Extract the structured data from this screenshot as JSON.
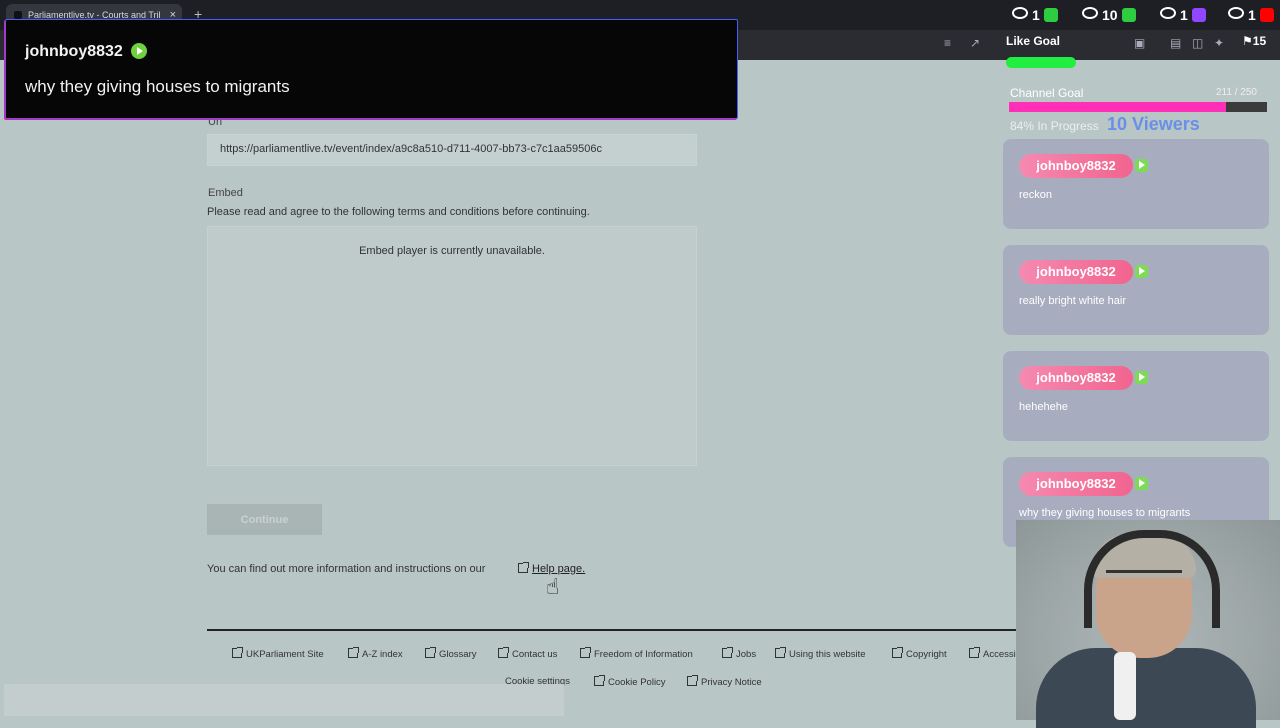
{
  "browser": {
    "tab_title": "Parliamentlive.tv - Courts and Tribu",
    "tab_close": "×",
    "new_tab": "+"
  },
  "stream_stats": [
    {
      "count": "1",
      "badge_color": "#2ecc40",
      "icon": "youtube-eye-icon"
    },
    {
      "count": "10",
      "badge_color": "#2ecc40",
      "icon": "kick-icon"
    },
    {
      "count": "1",
      "badge_color": "#9146ff",
      "icon": "twitch-icon"
    },
    {
      "count": "1",
      "badge_color": "#ff0000",
      "icon": "youtube-icon"
    }
  ],
  "chat_alert": {
    "username": "johnboy8832",
    "message": "why they giving houses to migrants"
  },
  "page": {
    "url_label": "Url",
    "url_value": "https://parliamentlive.tv/event/index/a9c8a510-d711-4007-bb73-c7c1aa59506c",
    "embed_label": "Embed",
    "terms_text": "Please read and agree to the following terms and conditions before continuing.",
    "embed_unavailable": "Embed player is currently unavailable.",
    "continue_label": "Continue",
    "help_text": "You can find out more information and instructions on our",
    "help_link": "Help page."
  },
  "footer": {
    "links": [
      "UKParliament Site",
      "A-Z index",
      "Glossary",
      "Contact us",
      "Freedom of Information",
      "Jobs",
      "Using this website",
      "Copyright",
      "Accessibility"
    ],
    "links2": [
      "Cookie settings",
      "Cookie Policy",
      "Privacy Notice"
    ]
  },
  "overlay": {
    "like_goal": "Like Goal",
    "like_goal_progress": 0.3,
    "top_right_number": "15",
    "channel_goal_title": "Channel Goal",
    "channel_goal_count": "211 / 250",
    "channel_goal_progress": 0.84,
    "channel_goal_status": "84% In Progress",
    "viewers": "10 Viewers",
    "chat": [
      {
        "user": "johnboy8832",
        "text": "reckon"
      },
      {
        "user": "johnboy8832",
        "text": "really bright white hair"
      },
      {
        "user": "johnboy8832",
        "text": "hehehehe"
      },
      {
        "user": "johnboy8832",
        "text": "why they giving houses to migrants"
      }
    ]
  },
  "colors": {
    "accent_pink": "#ff2fb8",
    "chat_pill": "#f2648f",
    "badge_green": "#6fd13f",
    "viewer_blue": "#6a8fe6"
  }
}
